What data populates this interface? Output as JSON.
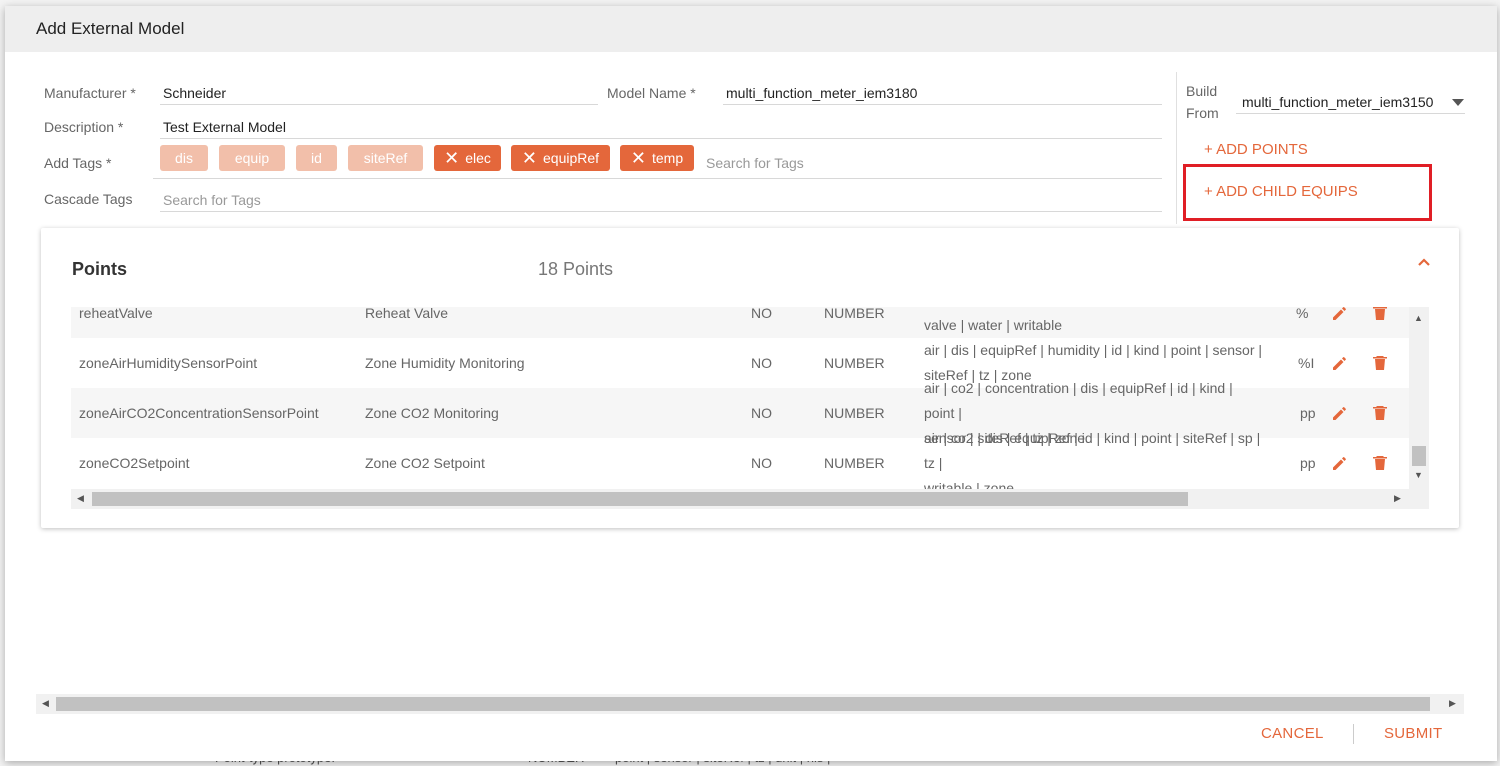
{
  "modal": {
    "title": "Add External Model"
  },
  "form": {
    "manufacturer_label": "Manufacturer *",
    "manufacturer_value": "Schneider",
    "model_name_label": "Model Name *",
    "model_name_value": "multi_function_meter_iem3180",
    "description_label": "Description *",
    "description_value": "Test External Model",
    "add_tags_label": "Add Tags *",
    "cascade_tags_label": "Cascade Tags",
    "tags_placeholder": "Search for Tags",
    "cascade_placeholder": "Search for Tags",
    "build_from_label_line1": "Build",
    "build_from_label_line2": "From",
    "build_from_value": "multi_function_meter_iem3150"
  },
  "tags": [
    {
      "label": "dis",
      "removable": false
    },
    {
      "label": "equip",
      "removable": false
    },
    {
      "label": "id",
      "removable": false
    },
    {
      "label": "siteRef",
      "removable": false
    },
    {
      "label": "elec",
      "removable": true
    },
    {
      "label": "equipRef",
      "removable": true
    },
    {
      "label": "temp",
      "removable": true
    }
  ],
  "actions": {
    "add_points": "+ ADD POINTS",
    "add_child_equips": "+ ADD CHILD EQUIPS"
  },
  "points": {
    "title": "Points",
    "count": "18 Points",
    "rows": [
      {
        "name": "reheatValve",
        "display": "Reheat Valve",
        "bool": "NO",
        "kind": "NUMBER",
        "tags_line1": "",
        "tags_line2": "valve | water | writable",
        "unit": "%"
      },
      {
        "name": "zoneAirHumiditySensorPoint",
        "display": "Zone Humidity Monitoring",
        "bool": "NO",
        "kind": "NUMBER",
        "tags_line1": "air | dis | equipRef | humidity | id | kind | point | sensor |",
        "tags_line2": "siteRef | tz | zone",
        "unit": "%I"
      },
      {
        "name": "zoneAirCO2ConcentrationSensorPoint",
        "display": "Zone CO2 Monitoring",
        "bool": "NO",
        "kind": "NUMBER",
        "tags_line1": "air | co2 | concentration | dis | equipRef | id | kind | point |",
        "tags_line2": "sensor | siteRef | tz | zone",
        "unit": "pp"
      },
      {
        "name": "zoneCO2Setpoint",
        "display": "Zone CO2 Setpoint",
        "bool": "NO",
        "kind": "NUMBER",
        "tags_line1": "air | co2 | dis | equipRef | id | kind | point | siteRef | sp | tz |",
        "tags_line2": "writable | zone",
        "unit": "pp"
      }
    ]
  },
  "footer": {
    "cancel": "CANCEL",
    "submit": "SUBMIT"
  },
  "colors": {
    "accent": "#e4673b",
    "tag_light": "#f2bfaa",
    "highlight": "#e01e25"
  },
  "background": {
    "bottom_text_1": "Point-type prototype.",
    "bottom_text_2": "NUMBER",
    "bottom_text_3": "point | sensor | siteRef | tz | unit | his |"
  }
}
